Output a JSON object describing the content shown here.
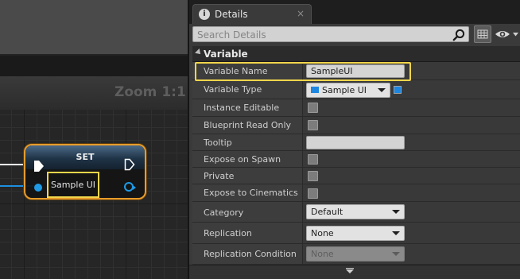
{
  "graph": {
    "zoom_label": "Zoom 1:1",
    "set_node": {
      "title": "SET",
      "variable_label": "Sample UI"
    }
  },
  "details": {
    "tab_label": "Details",
    "tab_close": "×",
    "search": {
      "placeholder": "Search Details",
      "value": ""
    },
    "section_title": "Variable",
    "rows": {
      "variable_name": {
        "label": "Variable Name",
        "value": "SampleUI"
      },
      "variable_type": {
        "label": "Variable Type",
        "value": "Sample UI"
      },
      "instance_editable": {
        "label": "Instance Editable",
        "checked": false
      },
      "blueprint_read_only": {
        "label": "Blueprint Read Only",
        "checked": false
      },
      "tooltip": {
        "label": "Tooltip",
        "value": ""
      },
      "expose_on_spawn": {
        "label": "Expose on Spawn",
        "checked": false
      },
      "private": {
        "label": "Private",
        "checked": false
      },
      "expose_to_cinematics": {
        "label": "Expose to Cinematics",
        "checked": false
      },
      "category": {
        "label": "Category",
        "value": "Default"
      },
      "replication": {
        "label": "Replication",
        "value": "None"
      },
      "replication_condition": {
        "label": "Replication Condition",
        "value": "None"
      }
    }
  },
  "colors": {
    "node_outline": "#e89c2a",
    "highlight": "#f2d64b",
    "object_pin": "#1d86e0"
  }
}
